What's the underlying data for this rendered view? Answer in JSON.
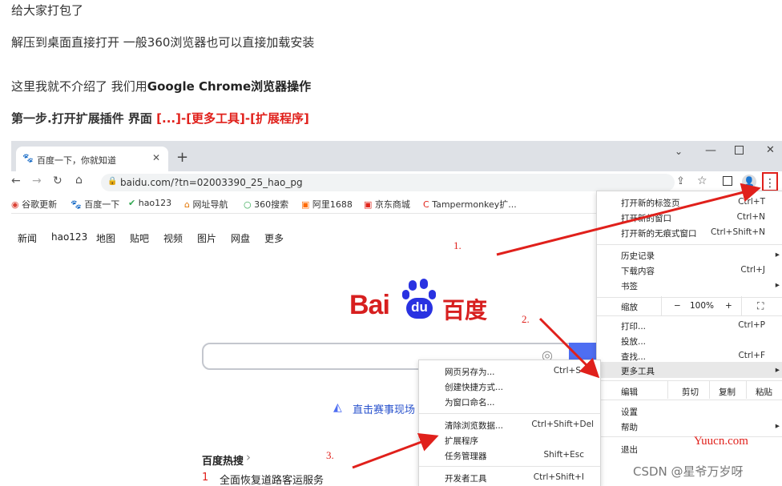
{
  "article": {
    "line1": "给大家打包了",
    "line2": "解压到桌面直接打开 一般360浏览器也可以直接加载安装",
    "line3_prefix": "这里我就不介绍了 我们用",
    "line3_bold": "Google Chrome浏览器操作",
    "line4_bold": "第一步.打开扩展插件 界面 ",
    "line4_red": "[...]-[更多工具]-[扩展程序]"
  },
  "browser": {
    "tab_title": "百度一下，你就知道",
    "url": "baidu.com/?tn=02003390_25_hao_pg",
    "bookmarks": [
      "谷歌更新",
      "百度一下",
      "hao123",
      "网址导航",
      "360搜索",
      "阿里1688",
      "京东商城",
      "Tampermonkey扩..."
    ],
    "baidu_nav": [
      "新闻",
      "hao123",
      "地图",
      "贴吧",
      "视频",
      "图片",
      "网盘",
      "更多"
    ],
    "baidu_logo_left": "Bai",
    "baidu_logo_paw": "du",
    "baidu_logo_right": "百度",
    "live_link": "直击赛事现场",
    "hot_title": "百度热搜",
    "hot_chevron": "›",
    "hot_rank": "1",
    "hot_item": "全面恢复道路客运服务"
  },
  "main_menu": {
    "items": [
      {
        "label": "打开新的标签页",
        "shortcut": "Ctrl+T"
      },
      {
        "label": "打开新的窗口",
        "shortcut": "Ctrl+N"
      },
      {
        "label": "打开新的无痕式窗口",
        "shortcut": "Ctrl+Shift+N"
      },
      {
        "label": "历史记录",
        "shortcut": "▸"
      },
      {
        "label": "下载内容",
        "shortcut": "Ctrl+J"
      },
      {
        "label": "书签",
        "shortcut": "▸"
      },
      {
        "label": "打印...",
        "shortcut": "Ctrl+P"
      },
      {
        "label": "投放...",
        "shortcut": ""
      },
      {
        "label": "查找...",
        "shortcut": "Ctrl+F"
      },
      {
        "label": "更多工具",
        "shortcut": "▸"
      },
      {
        "label": "设置",
        "shortcut": ""
      },
      {
        "label": "帮助",
        "shortcut": "▸"
      },
      {
        "label": "退出",
        "shortcut": ""
      }
    ],
    "zoom_label": "缩放",
    "zoom_minus": "−",
    "zoom_value": "100%",
    "zoom_plus": "+",
    "edit_label": "编辑",
    "cut": "剪切",
    "copy": "复制",
    "paste": "粘贴"
  },
  "sub_menu": {
    "items": [
      {
        "label": "网页另存为...",
        "shortcut": "Ctrl+S"
      },
      {
        "label": "创建快捷方式...",
        "shortcut": ""
      },
      {
        "label": "为窗口命名...",
        "shortcut": ""
      },
      {
        "label": "清除浏览数据...",
        "shortcut": "Ctrl+Shift+Del"
      },
      {
        "label": "扩展程序",
        "shortcut": ""
      },
      {
        "label": "任务管理器",
        "shortcut": "Shift+Esc"
      },
      {
        "label": "开发者工具",
        "shortcut": "Ctrl+Shift+I"
      }
    ]
  },
  "annotations": {
    "step1": "1.",
    "step2": "2.",
    "step3": "3."
  },
  "watermark": {
    "site": "Yuucn.com",
    "author": "CSDN @星爷万岁呀"
  },
  "colors": {
    "accent_red": "#e0201b",
    "baidu_red": "#d71f1f",
    "baidu_blue": "#2932e1",
    "tab_bar": "#dee1e6"
  }
}
